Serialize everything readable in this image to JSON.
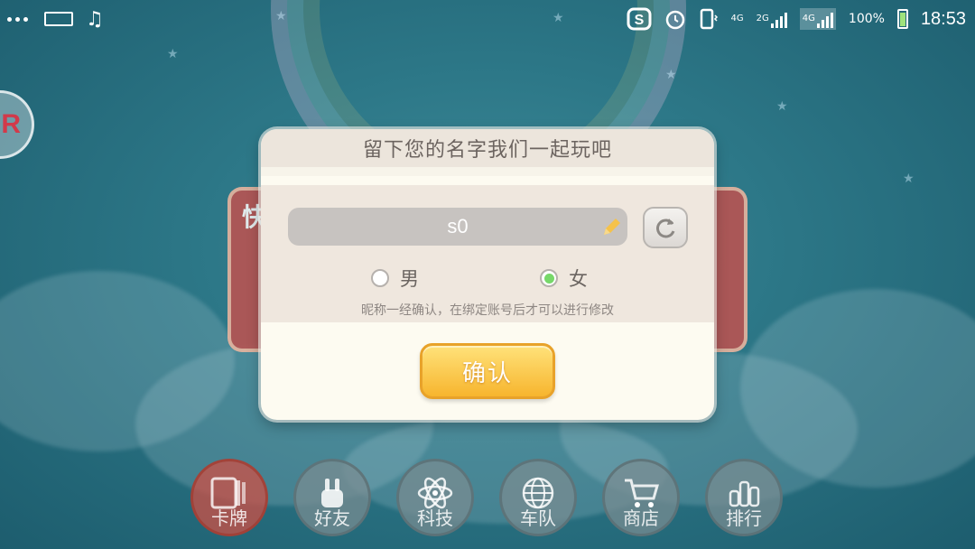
{
  "status_bar": {
    "time": "18:53",
    "battery_percent": "100%",
    "net_label_1": "4G",
    "net_label_2": "2G",
    "net_label_3": "4G",
    "icons": [
      "more-dots-icon",
      "keyboard-icon",
      "music-icon",
      "sogou-icon",
      "alarm-icon",
      "phone-vibrate-icon",
      "signal-icon",
      "battery-icon"
    ]
  },
  "dialog": {
    "title": "留下您的名字我们一起玩吧",
    "name_value": "s0",
    "gender_male": "男",
    "gender_female": "女",
    "selected_gender": "女",
    "hint": "昵称一经确认，在绑定账号后才可以进行修改",
    "confirm_label": "确认"
  },
  "back_card": {
    "title_char": "快"
  },
  "bottom_nav": {
    "items": [
      {
        "label": "卡牌",
        "icon": "cards-icon"
      },
      {
        "label": "好友",
        "icon": "rabbit-icon"
      },
      {
        "label": "科技",
        "icon": "atom-icon"
      },
      {
        "label": "车队",
        "icon": "globe-icon"
      },
      {
        "label": "商店",
        "icon": "cart-icon"
      },
      {
        "label": "排行",
        "icon": "ranking-icon"
      }
    ]
  },
  "colors": {
    "accent_yellow": "#f7b52e",
    "radio_checked": "#77d86a"
  }
}
